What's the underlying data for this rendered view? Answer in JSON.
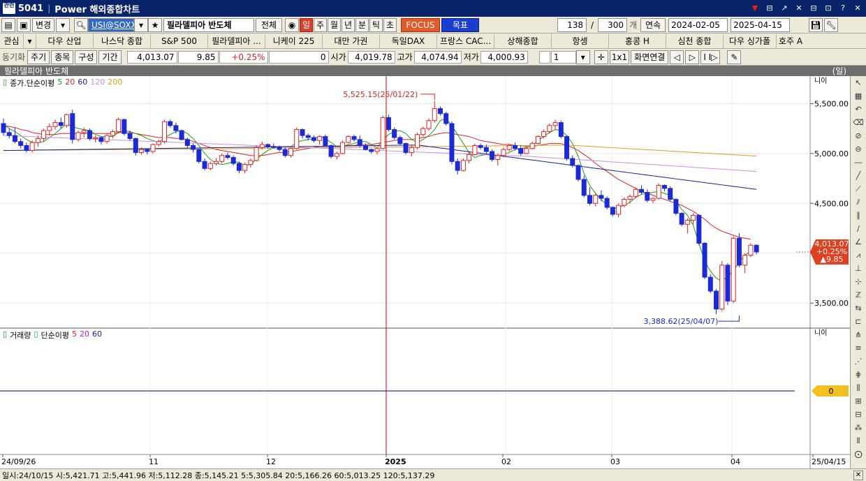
{
  "titlebar": {
    "screen_no": "5041",
    "title": "Power 해외종합차트",
    "badge": "관련",
    "buttons": [
      "▼",
      "⊟",
      "↗",
      "✕",
      "⊟",
      "⊡",
      "?",
      "✕"
    ]
  },
  "toolbar": {
    "change_label": "변경",
    "symbol_code": "USI@SOXX",
    "symbol_name": "필라델피아 반도체",
    "all_label": "전체",
    "periods": [
      "일",
      "주",
      "월",
      "년",
      "분",
      "틱",
      "초"
    ],
    "active_period": "일",
    "focus_label": "FOCUS",
    "target_label": "목표",
    "count_value": "138",
    "slash": "/",
    "total_value": "300",
    "count_unit": "개",
    "continuous_label": "연속",
    "date_from": "2024-02-05",
    "date_to": "2025-04-15"
  },
  "markets": {
    "interest_label": "관심",
    "items": [
      "다우 산업",
      "나스닥 종합",
      "S&P 500",
      "필라델피아 ...",
      "니케이 225",
      "대만 가권",
      "독일DAX",
      "프랑스 CAC...",
      "상해종합",
      "항셍",
      "홍콩 H",
      "심천 종합",
      "다우 싱가폴",
      "호주 A"
    ]
  },
  "quote": {
    "sync_label": "동기화",
    "buttons": [
      "주기",
      "종목",
      "구성",
      "기간"
    ],
    "price": "4,013.07",
    "change": "9.85",
    "change_pct": "+0.25%",
    "volume": "0",
    "open_label": "시가",
    "open": "4,019.78",
    "high_label": "고가",
    "high": "4,074.94",
    "low_label": "저가",
    "low": "4,000.93",
    "count": "1",
    "one_x": "1x1",
    "screen_link": "화면연결"
  },
  "chart_header": {
    "name": "필라델피아 반도체",
    "period": "(일)"
  },
  "price_panel": {
    "legend_label": "종가.단순이평",
    "ma_labels": [
      "5",
      "20",
      "60",
      "120",
      "200"
    ],
    "ma_colors": [
      "#1a9a1a",
      "#e02020",
      "#1a1aa0",
      "#c890e0",
      "#d9a020"
    ],
    "y_ticks": [
      "5,500.00",
      "5,000.00",
      "4,500.00",
      "4,000.00",
      "3,500.00"
    ],
    "y_values": [
      5500,
      5000,
      4500,
      4000,
      3500
    ],
    "y_range": [
      3340,
      5720
    ],
    "high_annotation": "5,525.15(25/01/22)",
    "low_annotation": "3,388.62(25/04/07)",
    "current_price": "4,013.07",
    "current_change_pct": "+0.25%",
    "current_change": "▲9.85",
    "corner_label": "니이"
  },
  "volume_panel": {
    "legend_label": "거래량",
    "legend_ma_label": "단순이평",
    "ma_labels": [
      "5",
      "20",
      "60"
    ],
    "ma_colors": [
      "#e02020",
      "#c020c0",
      "#1a1aa0"
    ],
    "zero_label": "0",
    "corner_label": "니이"
  },
  "x_axis": {
    "labels": [
      "24/09/26",
      "11",
      "12",
      "2025",
      "02",
      "03",
      "04",
      "25/04/15"
    ]
  },
  "status": {
    "text": "일시:24/10/15 시:5,421.71 고:5,441.96 저:5,112.28 종:5,145.21 5:5,305.84 20:5,166.26 60:5,013.25 120:5,137.29"
  },
  "colors": {
    "up": "#e02020",
    "down": "#1a2ad8",
    "title_bg": "#0a246a",
    "price_tag": "#e04020",
    "zero_tag": "#f0c020"
  },
  "chart_data": {
    "type": "candlestick",
    "title": "필라델피아 반도체",
    "x_start": "24/09/26",
    "x_end": "25/04/15",
    "ylim": [
      3340,
      5720
    ],
    "candles": [
      [
        5300,
        5350,
        5180,
        5210
      ],
      [
        5210,
        5250,
        5150,
        5180
      ],
      [
        5180,
        5260,
        5100,
        5120
      ],
      [
        5120,
        5150,
        5050,
        5080
      ],
      [
        5080,
        5110,
        5010,
        5030
      ],
      [
        5030,
        5130,
        5010,
        5110
      ],
      [
        5110,
        5180,
        5070,
        5150
      ],
      [
        5150,
        5250,
        5120,
        5230
      ],
      [
        5230,
        5300,
        5180,
        5270
      ],
      [
        5270,
        5340,
        5240,
        5310
      ],
      [
        5310,
        5360,
        5250,
        5280
      ],
      [
        5280,
        5400,
        5260,
        5390
      ],
      [
        5400,
        5440,
        5100,
        5140
      ],
      [
        5140,
        5230,
        5120,
        5210
      ],
      [
        5210,
        5260,
        5160,
        5230
      ],
      [
        5230,
        5250,
        5130,
        5150
      ],
      [
        5150,
        5180,
        5110,
        5160
      ],
      [
        5160,
        5170,
        5090,
        5120
      ],
      [
        5120,
        5200,
        5100,
        5180
      ],
      [
        5180,
        5240,
        5150,
        5220
      ],
      [
        5220,
        5360,
        5200,
        5340
      ],
      [
        5340,
        5350,
        5180,
        5200
      ],
      [
        5200,
        5230,
        5130,
        5150
      ],
      [
        5150,
        5160,
        4980,
        5010
      ],
      [
        5010,
        5060,
        4990,
        5040
      ],
      [
        5040,
        5050,
        4990,
        5020
      ],
      [
        5020,
        5100,
        5000,
        5090
      ],
      [
        5090,
        5140,
        5070,
        5120
      ],
      [
        5120,
        5340,
        5100,
        5320
      ],
      [
        5320,
        5340,
        5260,
        5280
      ],
      [
        5280,
        5310,
        5200,
        5230
      ],
      [
        5230,
        5240,
        5130,
        5140
      ],
      [
        5140,
        5160,
        5050,
        5080
      ],
      [
        5080,
        5100,
        5010,
        5040
      ],
      [
        5040,
        5050,
        4900,
        4920
      ],
      [
        4920,
        4950,
        4830,
        4850
      ],
      [
        4850,
        4920,
        4830,
        4900
      ],
      [
        4900,
        4950,
        4880,
        4920
      ],
      [
        4920,
        5000,
        4900,
        4980
      ],
      [
        4980,
        5010,
        4940,
        4960
      ],
      [
        4960,
        4980,
        4880,
        4900
      ],
      [
        4900,
        4920,
        4800,
        4830
      ],
      [
        4830,
        4910,
        4800,
        4890
      ],
      [
        4890,
        4950,
        4860,
        4930
      ],
      [
        4930,
        5080,
        4920,
        5060
      ],
      [
        5060,
        5120,
        5040,
        5090
      ],
      [
        5090,
        5100,
        5050,
        5070
      ],
      [
        5070,
        5100,
        5050,
        5060
      ],
      [
        5060,
        5080,
        5020,
        5040
      ],
      [
        5040,
        5060,
        4960,
        4980
      ],
      [
        4980,
        5060,
        4960,
        5050
      ],
      [
        5050,
        5260,
        5040,
        5240
      ],
      [
        5240,
        5250,
        5150,
        5180
      ],
      [
        5180,
        5200,
        5130,
        5160
      ],
      [
        5160,
        5180,
        5110,
        5130
      ],
      [
        5130,
        5180,
        5090,
        5170
      ],
      [
        5170,
        5190,
        5070,
        5080
      ],
      [
        5080,
        5090,
        4950,
        4970
      ],
      [
        4970,
        5020,
        4940,
        5000
      ],
      [
        5000,
        5130,
        4990,
        5110
      ],
      [
        5110,
        5180,
        5100,
        5170
      ],
      [
        5170,
        5190,
        5120,
        5140
      ],
      [
        5140,
        5180,
        5060,
        5080
      ],
      [
        5080,
        5100,
        5030,
        5040
      ],
      [
        5040,
        5050,
        5000,
        5020
      ],
      [
        5020,
        5060,
        4990,
        5050
      ],
      [
        5050,
        5380,
        5040,
        5360
      ],
      [
        5360,
        5390,
        5220,
        5240
      ],
      [
        5240,
        5260,
        5140,
        5160
      ],
      [
        5160,
        5180,
        5080,
        5100
      ],
      [
        5100,
        5110,
        4990,
        5010
      ],
      [
        5010,
        5080,
        4970,
        5060
      ],
      [
        5060,
        5210,
        5040,
        5190
      ],
      [
        5190,
        5270,
        5170,
        5250
      ],
      [
        5250,
        5350,
        5230,
        5330
      ],
      [
        5330,
        5525,
        5310,
        5450
      ],
      [
        5450,
        5470,
        5380,
        5400
      ],
      [
        5400,
        5420,
        5280,
        5300
      ],
      [
        5300,
        5320,
        4890,
        4920
      ],
      [
        4920,
        4950,
        4790,
        4830
      ],
      [
        4830,
        4950,
        4820,
        4930
      ],
      [
        4930,
        5010,
        4900,
        4990
      ],
      [
        4990,
        5100,
        4980,
        5080
      ],
      [
        5080,
        5100,
        5040,
        5060
      ],
      [
        5060,
        5090,
        5000,
        5020
      ],
      [
        5020,
        5040,
        4920,
        4940
      ],
      [
        4940,
        5000,
        4880,
        4980
      ],
      [
        4980,
        5060,
        4960,
        5040
      ],
      [
        5040,
        5100,
        5020,
        5080
      ],
      [
        5080,
        5110,
        5030,
        5050
      ],
      [
        5050,
        5080,
        4980,
        5000
      ],
      [
        5000,
        5060,
        4990,
        5050
      ],
      [
        5050,
        5120,
        5040,
        5100
      ],
      [
        5100,
        5180,
        5090,
        5170
      ],
      [
        5170,
        5240,
        5150,
        5220
      ],
      [
        5220,
        5300,
        5200,
        5280
      ],
      [
        5280,
        5340,
        5240,
        5310
      ],
      [
        5310,
        5330,
        5150,
        5170
      ],
      [
        5170,
        5180,
        4930,
        4950
      ],
      [
        4950,
        4980,
        4860,
        4880
      ],
      [
        4880,
        4890,
        4720,
        4740
      ],
      [
        4740,
        4780,
        4560,
        4580
      ],
      [
        4580,
        4660,
        4480,
        4500
      ],
      [
        4500,
        4600,
        4470,
        4580
      ],
      [
        4580,
        4630,
        4520,
        4550
      ],
      [
        4550,
        4570,
        4440,
        4460
      ],
      [
        4460,
        4470,
        4370,
        4390
      ],
      [
        4390,
        4500,
        4360,
        4480
      ],
      [
        4480,
        4560,
        4460,
        4540
      ],
      [
        4540,
        4590,
        4500,
        4570
      ],
      [
        4570,
        4660,
        4550,
        4640
      ],
      [
        4640,
        4680,
        4590,
        4610
      ],
      [
        4610,
        4640,
        4510,
        4530
      ],
      [
        4530,
        4560,
        4500,
        4550
      ],
      [
        4550,
        4700,
        4540,
        4680
      ],
      [
        4680,
        4690,
        4620,
        4650
      ],
      [
        4650,
        4670,
        4520,
        4540
      ],
      [
        4540,
        4550,
        4380,
        4400
      ],
      [
        4400,
        4410,
        4270,
        4290
      ],
      [
        4290,
        4350,
        4200,
        4330
      ],
      [
        4330,
        4400,
        4290,
        4380
      ],
      [
        4380,
        4390,
        4080,
        4100
      ],
      [
        4100,
        4110,
        3740,
        3760
      ],
      [
        3760,
        3790,
        3600,
        3620
      ],
      [
        3620,
        3640,
        3388,
        3440
      ],
      [
        3440,
        3920,
        3420,
        3880
      ],
      [
        3880,
        3900,
        3480,
        3520
      ],
      [
        3520,
        4170,
        3500,
        4150
      ],
      [
        4150,
        4200,
        3860,
        3880
      ],
      [
        3880,
        4000,
        3800,
        3980
      ],
      [
        3980,
        4100,
        3960,
        4080
      ],
      [
        4080,
        4090,
        3990,
        4013
      ]
    ],
    "ma5": [
      5290,
      5250,
      5220,
      5180,
      5140,
      5110,
      5110,
      5120,
      5160,
      5200,
      5250,
      5300,
      5270,
      5250,
      5240,
      5230,
      5190,
      5170,
      5170,
      5170,
      5210,
      5230,
      5220,
      5200,
      5180,
      5150,
      5130,
      5110,
      5160,
      5190,
      5220,
      5230,
      5200,
      5150,
      5080,
      5000,
      4940,
      4900,
      4890,
      4900,
      4920,
      4910,
      4880,
      4890,
      4940,
      4990,
      5030,
      5060,
      5070,
      5070,
      5070,
      5110,
      5130,
      5140,
      5150,
      5170,
      5150,
      5110,
      5070,
      5070,
      5090,
      5100,
      5120,
      5120,
      5090,
      5060,
      5140,
      5190,
      5220,
      5230,
      5200,
      5140,
      5110,
      5140,
      5180,
      5240,
      5330,
      5350,
      5280,
      5190,
      5100,
      5010,
      4960,
      4980,
      4990,
      4980,
      4980,
      4990,
      5010,
      5040,
      5050,
      5060,
      5080,
      5130,
      5170,
      5210,
      5240,
      5230,
      5180,
      5100,
      4970,
      4800,
      4680,
      4600,
      4540,
      4480,
      4450,
      4460,
      4480,
      4510,
      4560,
      4590,
      4600,
      4610,
      4620,
      4600,
      4580,
      4520,
      4440,
      4380,
      4280,
      4100,
      3920,
      3820,
      3750,
      3720,
      3770,
      3820,
      3910,
      3980,
      4020
    ],
    "ma20": [
      5280,
      5270,
      5260,
      5240,
      5230,
      5210,
      5200,
      5190,
      5190,
      5190,
      5200,
      5200,
      5200,
      5200,
      5200,
      5200,
      5200,
      5200,
      5200,
      5200,
      5210,
      5210,
      5210,
      5200,
      5190,
      5180,
      5170,
      5160,
      5160,
      5160,
      5150,
      5150,
      5140,
      5120,
      5100,
      5080,
      5060,
      5040,
      5030,
      5020,
      5010,
      5000,
      4990,
      4980,
      4980,
      4980,
      4990,
      5000,
      5010,
      5010,
      5020,
      5030,
      5040,
      5050,
      5060,
      5070,
      5070,
      5070,
      5070,
      5070,
      5080,
      5080,
      5090,
      5090,
      5090,
      5100,
      5110,
      5120,
      5130,
      5140,
      5140,
      5140,
      5150,
      5160,
      5170,
      5190,
      5200,
      5210,
      5200,
      5190,
      5180,
      5170,
      5150,
      5130,
      5120,
      5110,
      5100,
      5090,
      5090,
      5080,
      5080,
      5070,
      5070,
      5080,
      5090,
      5100,
      5100,
      5100,
      5080,
      5060,
      5030,
      4990,
      4950,
      4900,
      4860,
      4820,
      4780,
      4740,
      4710,
      4680,
      4650,
      4620,
      4600,
      4580,
      4560,
      4540,
      4520,
      4500,
      4480,
      4450,
      4420,
      4380,
      4340,
      4290,
      4250,
      4220,
      4200,
      4180,
      4160,
      4150,
      4140
    ]
  }
}
